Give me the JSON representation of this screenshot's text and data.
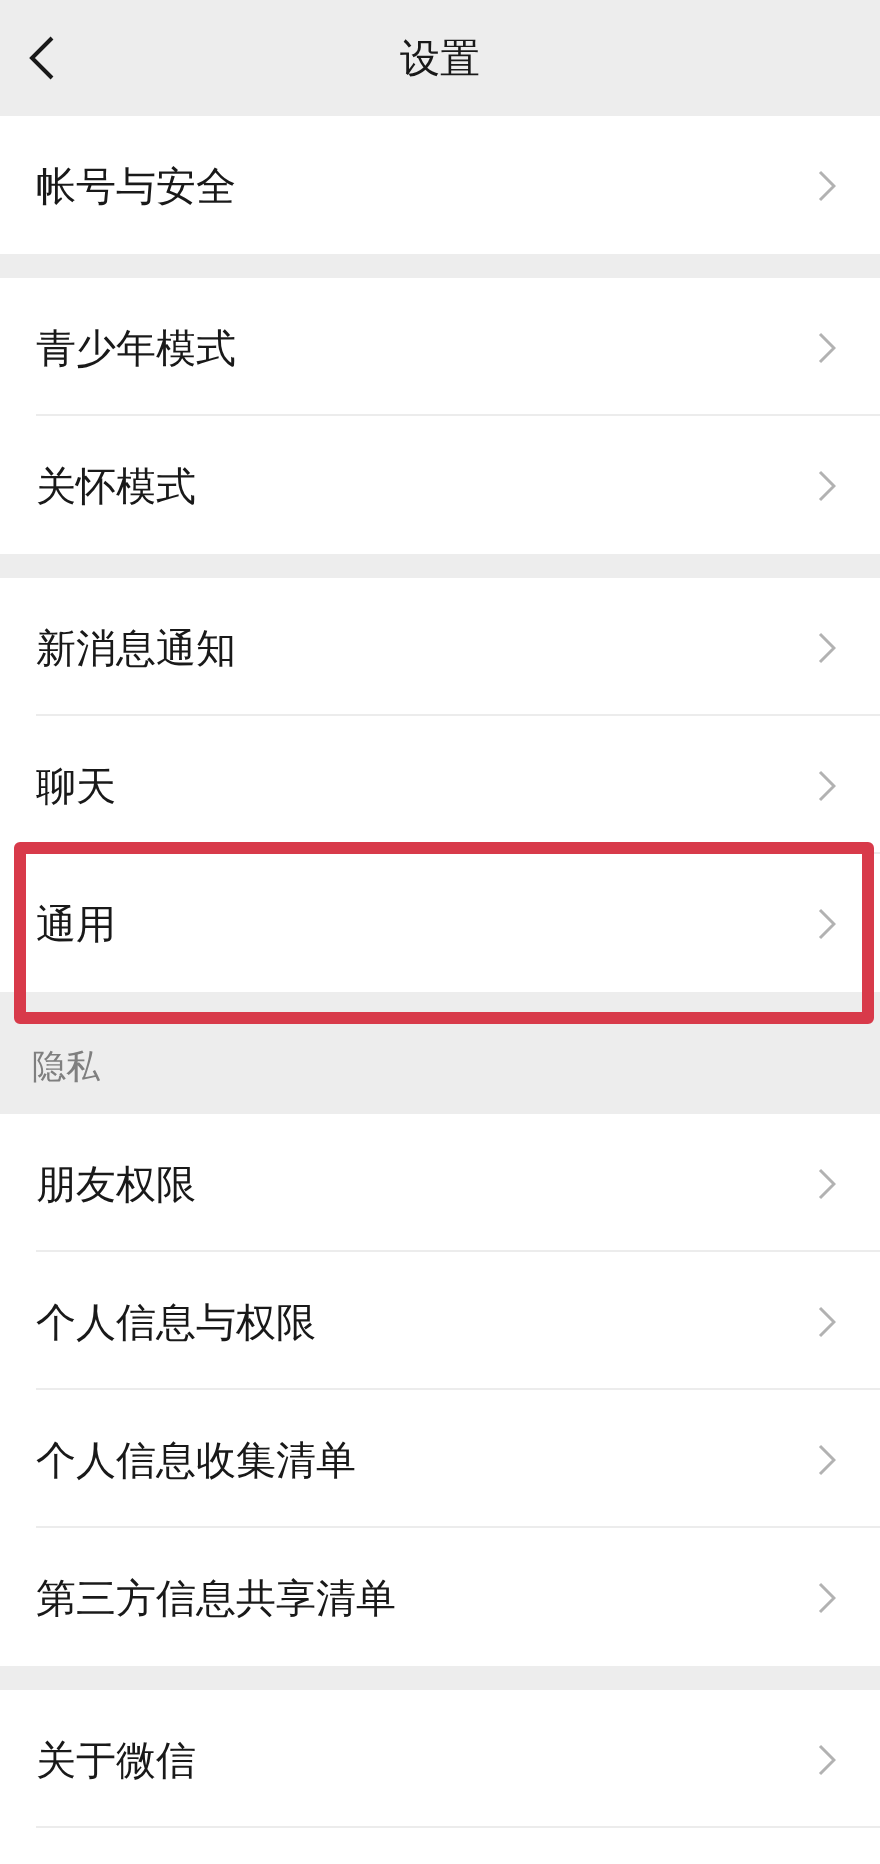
{
  "header": {
    "title": "设置"
  },
  "groups": [
    {
      "items": [
        {
          "label": "帐号与安全",
          "highlighted": false
        }
      ]
    },
    {
      "items": [
        {
          "label": "青少年模式",
          "highlighted": false
        },
        {
          "label": "关怀模式",
          "highlighted": false
        }
      ]
    },
    {
      "items": [
        {
          "label": "新消息通知",
          "highlighted": false
        },
        {
          "label": "聊天",
          "highlighted": false
        },
        {
          "label": "通用",
          "highlighted": true
        }
      ]
    },
    {
      "title": "隐私",
      "items": [
        {
          "label": "朋友权限",
          "highlighted": false
        },
        {
          "label": "个人信息与权限",
          "highlighted": false
        },
        {
          "label": "个人信息收集清单",
          "highlighted": false
        },
        {
          "label": "第三方信息共享清单",
          "highlighted": false
        }
      ]
    },
    {
      "items": [
        {
          "label": "关于微信",
          "highlighted": false
        }
      ]
    }
  ]
}
